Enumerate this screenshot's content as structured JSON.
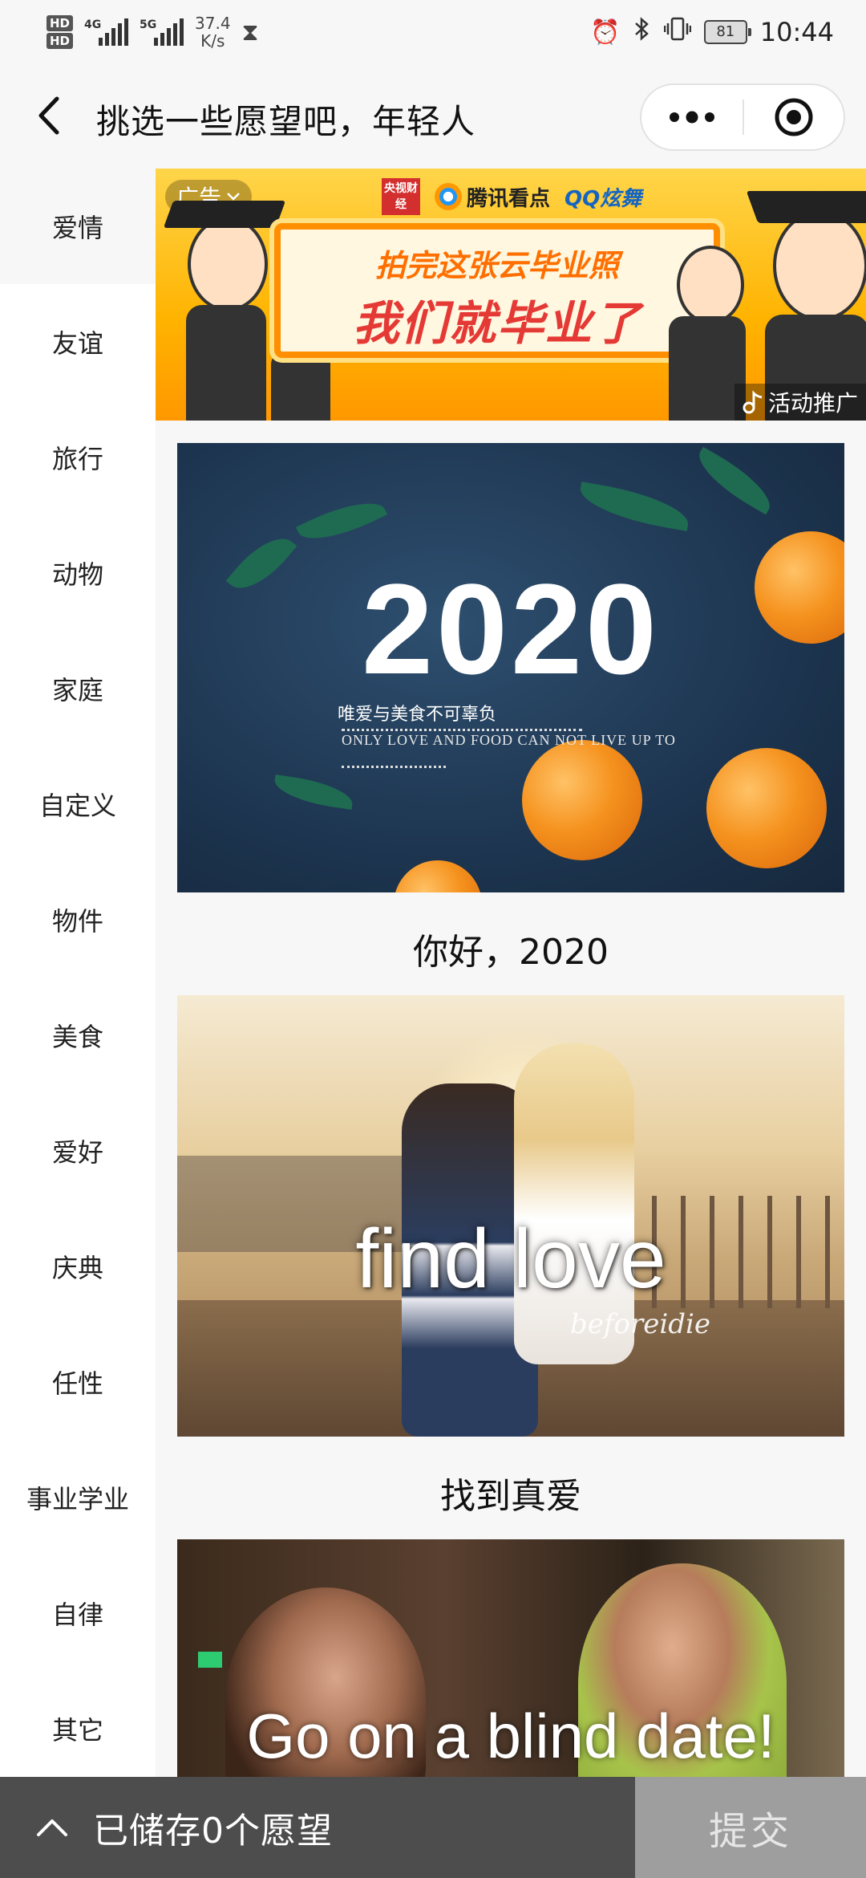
{
  "status_bar": {
    "hd1": "HD",
    "hd2": "HD",
    "net1": "4G",
    "net2": "5G",
    "speed_value": "37.4",
    "speed_unit": "K/s",
    "battery": "81",
    "time": "10:44"
  },
  "nav": {
    "title": "挑选一些愿望吧，年轻人"
  },
  "sidebar": {
    "active_index": 0,
    "items": [
      {
        "label": "爱情"
      },
      {
        "label": "友谊"
      },
      {
        "label": "旅行"
      },
      {
        "label": "动物"
      },
      {
        "label": "家庭"
      },
      {
        "label": "自定义"
      },
      {
        "label": "物件"
      },
      {
        "label": "美食"
      },
      {
        "label": "爱好"
      },
      {
        "label": "庆典"
      },
      {
        "label": "任性"
      },
      {
        "label": "事业学业"
      },
      {
        "label": "自律"
      },
      {
        "label": "其它"
      }
    ]
  },
  "ad": {
    "tag": "广告",
    "logo_cctv": "央视财经",
    "logo_tencent": "腾讯看点",
    "logo_qq": "QQ炫舞",
    "line1": "拍完这张云毕业照",
    "line2": "我们就毕业了",
    "footer": "活动推广"
  },
  "cards": [
    {
      "image_year": "2020",
      "image_subtitle": "唯爱与美食不可辜负",
      "image_english": "ONLY LOVE AND FOOD CAN NOT LIVE UP TO",
      "caption": "你好，2020"
    },
    {
      "image_text": "find love",
      "image_signature": "beforeidie",
      "caption": "找到真爱"
    },
    {
      "image_text": "Go on a blind date!"
    }
  ],
  "bottom": {
    "saved_text": "已储存0个愿望",
    "submit_label": "提交"
  }
}
